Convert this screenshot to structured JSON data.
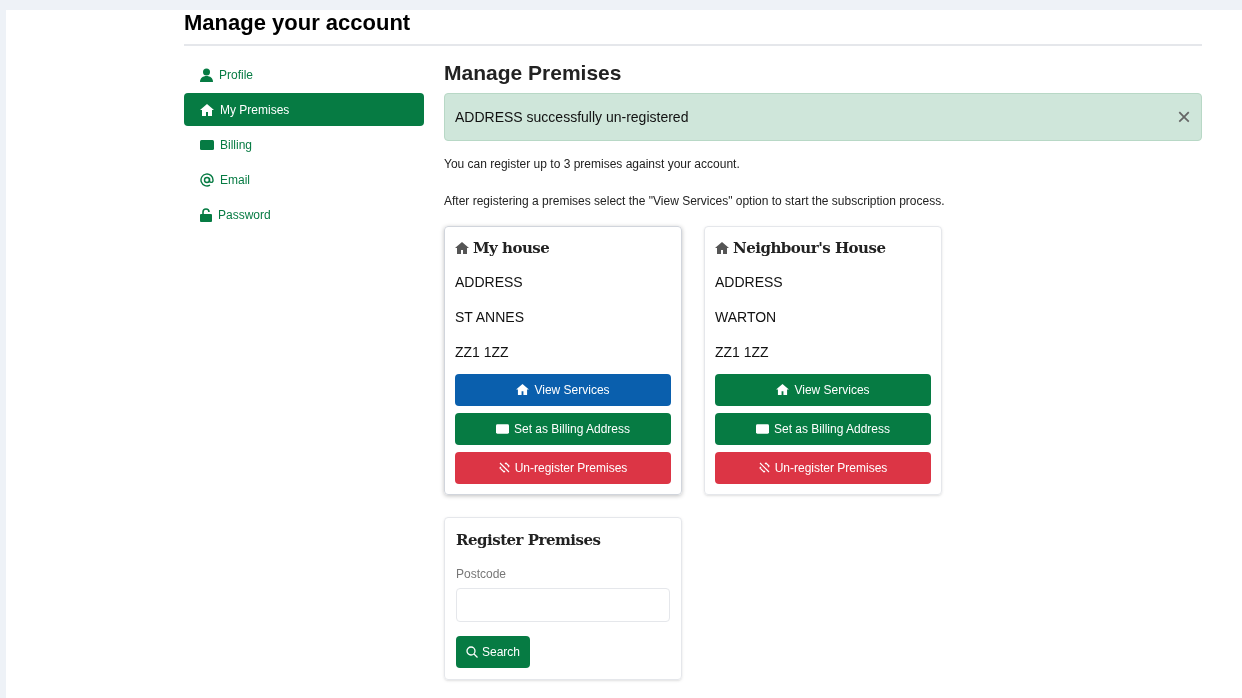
{
  "page_title": "Manage your account",
  "sidebar": {
    "items": [
      {
        "label": "Profile",
        "kind": "person",
        "selected": false
      },
      {
        "label": "My Premises",
        "kind": "home",
        "selected": true
      },
      {
        "label": "Billing",
        "kind": "wallet",
        "selected": false
      },
      {
        "label": "Email",
        "kind": "at",
        "selected": false
      },
      {
        "label": "Password",
        "kind": "lock",
        "selected": false
      }
    ]
  },
  "main": {
    "heading": "Manage Premises",
    "alert": {
      "message": "ADDRESS successfully un-registered",
      "close": "×"
    },
    "notes": [
      "You can register up to 3 premises against your account.",
      "After registering a premises select the \"View Services\" option to start the subscription process."
    ],
    "premises": [
      {
        "name": "My house",
        "lines": [
          "ADDRESS",
          "ST ANNES",
          "ZZ1 1ZZ"
        ],
        "selected": true,
        "buttons": [
          {
            "kind": "view",
            "label": "View Services",
            "focused": true
          },
          {
            "kind": "billing",
            "label": "Set as Billing Address",
            "focused": false
          },
          {
            "kind": "unregister",
            "label": "Un-register Premises",
            "focused": false
          }
        ]
      },
      {
        "name": "Neighbour's House",
        "lines": [
          "ADDRESS",
          "WARTON",
          "ZZ1 1ZZ"
        ],
        "selected": false,
        "buttons": [
          {
            "kind": "view",
            "label": "View Services",
            "focused": false
          },
          {
            "kind": "billing",
            "label": "Set as Billing Address",
            "focused": false
          },
          {
            "kind": "unregister",
            "label": "Un-register Premises",
            "focused": false
          }
        ]
      }
    ],
    "register": {
      "heading": "Register Premises",
      "field_label": "Postcode",
      "button": "Search"
    }
  }
}
